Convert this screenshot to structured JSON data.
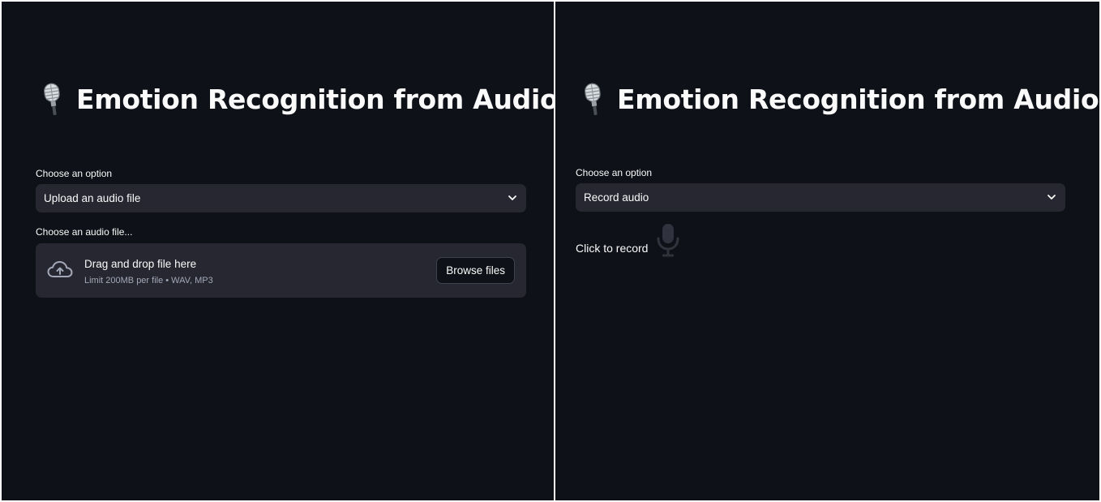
{
  "left_panel": {
    "title": "Emotion Recognition from Audio",
    "title_icon": "studio-microphone-icon",
    "option_label": "Choose an option",
    "option_selected": "Upload an audio file",
    "file_label": "Choose an audio file...",
    "dropzone_main": "Drag and drop file here",
    "dropzone_sub": "Limit 200MB per file • WAV, MP3",
    "browse_button": "Browse files",
    "upload_icon": "cloud-upload-icon"
  },
  "right_panel": {
    "title": "Emotion Recognition from Audio",
    "title_icon": "studio-microphone-icon",
    "option_label": "Choose an option",
    "option_selected": "Record audio",
    "record_label": "Click to record",
    "record_icon": "microphone-icon"
  },
  "colors": {
    "background": "#0e1117",
    "widget": "#262730",
    "text": "#fafafa",
    "muted_text": "#a3a8b8"
  }
}
